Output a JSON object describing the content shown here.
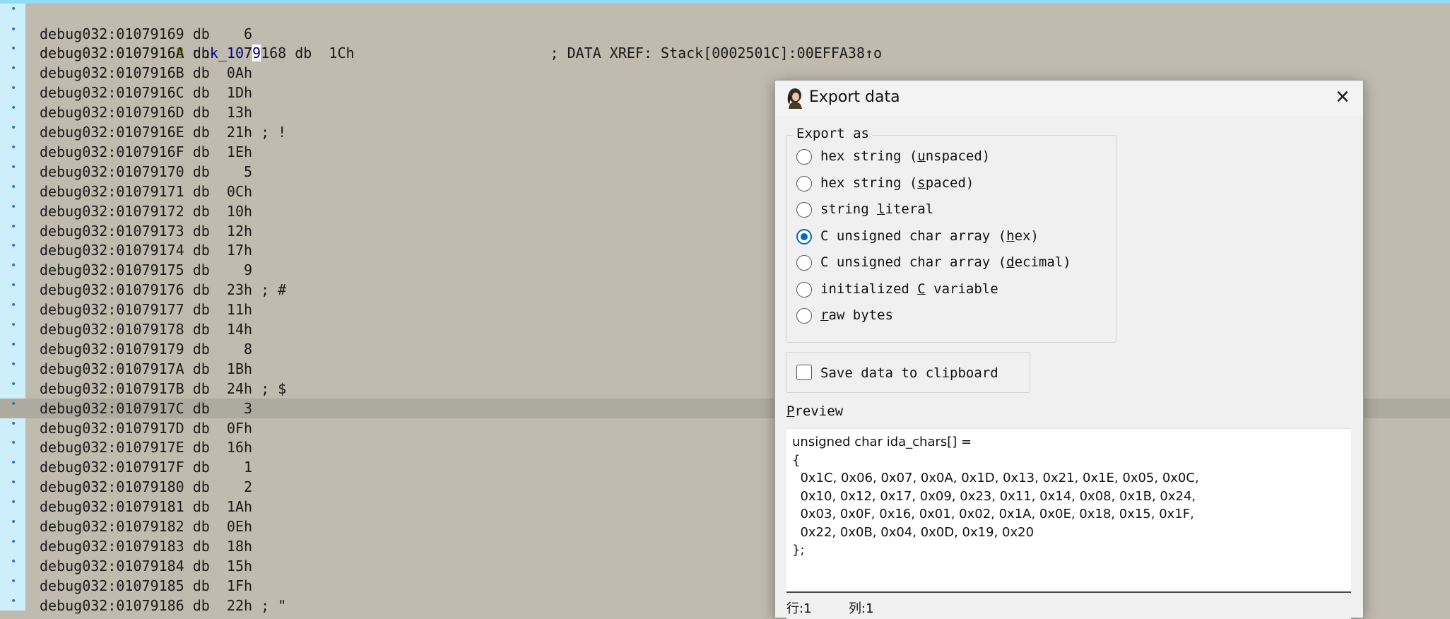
{
  "disassembly": {
    "first": {
      "addr": "debug032:01079168",
      "name_a": "unk_107",
      "name_sel": "9",
      "rest": "168 db  1Ch                       ; DATA XREF: Stack[0002501C]:00EFFA38↑o"
    },
    "lines": [
      "debug032:01079169 db    6",
      "debug032:0107916A db    7",
      "debug032:0107916B db  0Ah",
      "debug032:0107916C db  1Dh",
      "debug032:0107916D db  13h",
      "debug032:0107916E db  21h ; !",
      "debug032:0107916F db  1Eh",
      "debug032:01079170 db    5",
      "debug032:01079171 db  0Ch",
      "debug032:01079172 db  10h",
      "debug032:01079173 db  12h",
      "debug032:01079174 db  17h",
      "debug032:01079175 db    9",
      "debug032:01079176 db  23h ; #",
      "debug032:01079177 db  11h",
      "debug032:01079178 db  14h",
      "debug032:01079179 db    8",
      "debug032:0107917A db  1Bh",
      "debug032:0107917B db  24h ; $",
      "debug032:0107917C db    3",
      "debug032:0107917D db  0Fh",
      "debug032:0107917E db  16h",
      "debug032:0107917F db    1",
      "debug032:01079180 db    2",
      "debug032:01079181 db  1Ah",
      "debug032:01079182 db  0Eh",
      "debug032:01079183 db  18h",
      "debug032:01079184 db  15h",
      "debug032:01079185 db  1Fh",
      "debug032:01079186 db  22h ; \""
    ],
    "highlighted_line": "debug032:0107917C db    3",
    "bullet": "•"
  },
  "dialog": {
    "title": "Export data",
    "close_glyph": "✕",
    "export_as_label": "Export as",
    "options": [
      {
        "pre": "hex string (",
        "u": "u",
        "post": "nspaced)",
        "checked": false
      },
      {
        "pre": "hex string (",
        "u": "s",
        "post": "paced)",
        "checked": false
      },
      {
        "pre": "string ",
        "u": "l",
        "post": "iteral",
        "checked": false
      },
      {
        "pre": "C unsigned char array (",
        "u": "h",
        "post": "ex)",
        "checked": true
      },
      {
        "pre": "C unsigned char array (",
        "u": "d",
        "post": "ecimal)",
        "checked": false
      },
      {
        "pre": "initialized ",
        "u": "C",
        "post": " variable",
        "checked": false
      },
      {
        "pre": "",
        "u": "r",
        "post": "aw bytes",
        "checked": false
      }
    ],
    "clipboard_label": "Save data to clipboard",
    "preview_label_u": "P",
    "preview_label_rest": "review",
    "preview_text": "unsigned char ida_chars[] =\n{\n  0x1C, 0x06, 0x07, 0x0A, 0x1D, 0x13, 0x21, 0x1E, 0x05, 0x0C,\n  0x10, 0x12, 0x17, 0x09, 0x23, 0x11, 0x14, 0x08, 0x1B, 0x24,\n  0x03, 0x0F, 0x16, 0x01, 0x02, 0x1A, 0x0E, 0x18, 0x15, 0x1F,\n  0x22, 0x0B, 0x04, 0x0D, 0x19, 0x20\n};",
    "status_row": "行:1",
    "status_col": "列:1"
  }
}
